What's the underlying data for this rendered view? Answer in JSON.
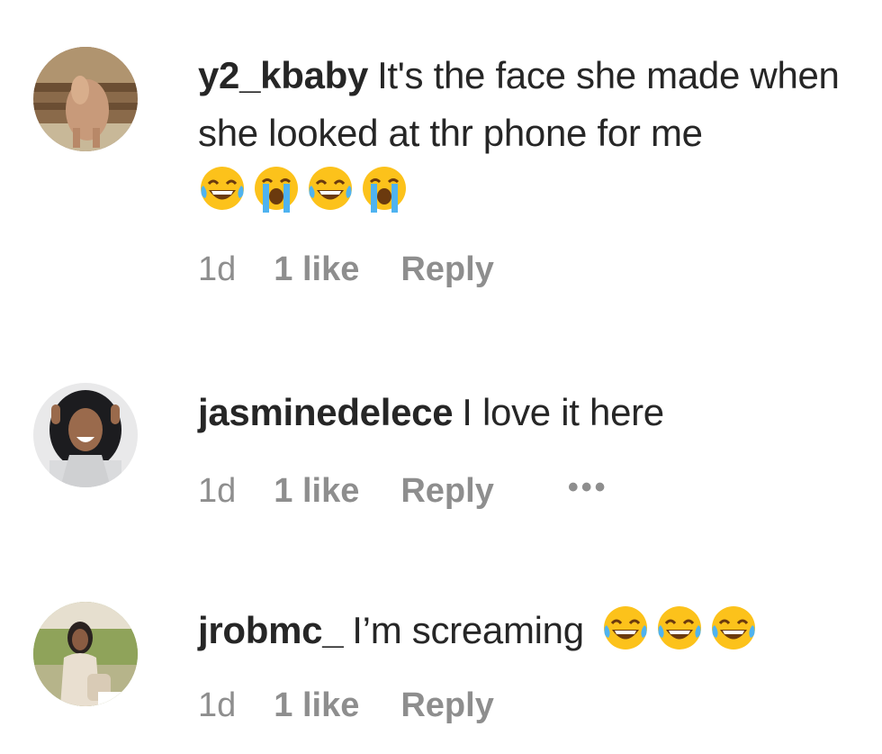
{
  "comments": [
    {
      "username": "y2_kbaby",
      "text": "It's the face she made when she looked at thr phone for me",
      "emojis": [
        "joy-emoji",
        "sob-emoji",
        "joy-emoji",
        "sob-emoji"
      ],
      "time": "1d",
      "likes": "1 like",
      "reply": "Reply",
      "avatar": "horse-photo-avatar"
    },
    {
      "username": "jasminedelece",
      "text": "I love it here",
      "emojis": [],
      "time": "1d",
      "likes": "1 like",
      "reply": "Reply",
      "more": "•••",
      "avatar": "woman-smiling-avatar"
    },
    {
      "username": "jrobmc_",
      "text": "I’m screaming",
      "emojis": [
        "joy-emoji",
        "joy-emoji",
        "joy-emoji"
      ],
      "time": "1d",
      "likes": "1 like",
      "reply": "Reply",
      "avatar": "woman-outdoors-avatar"
    }
  ],
  "colors": {
    "text": "#262626",
    "secondary": "#8e8e8e",
    "emoji_face": "#fcc21b",
    "emoji_tear": "#4fb3f0"
  }
}
